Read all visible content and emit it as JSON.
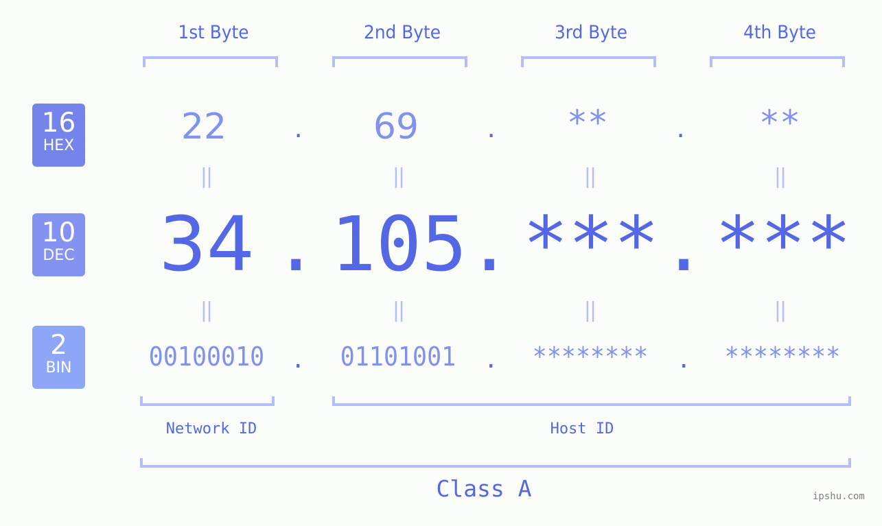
{
  "colors": {
    "primary": "#5468e6",
    "light": "#8291ee",
    "bracket": "#b5bef6",
    "hex_badge": "#7484ea",
    "dec_badge": "#8493f1",
    "bin_badge": "#8ea6f8",
    "background": "#fbfdfb"
  },
  "bytes": {
    "headers": [
      "1st Byte",
      "2nd Byte",
      "3rd Byte",
      "4th Byte"
    ]
  },
  "rows": {
    "hex": {
      "base": "16",
      "label": "HEX",
      "values": [
        "22",
        "69",
        "**",
        "**"
      ]
    },
    "dec": {
      "base": "10",
      "label": "DEC",
      "values": [
        "34",
        "105",
        "***",
        "***"
      ]
    },
    "bin": {
      "base": "2",
      "label": "BIN",
      "values": [
        "00100010",
        "01101001",
        "********",
        "********"
      ]
    }
  },
  "separator": ".",
  "equals": "||",
  "parts": {
    "network": "Network ID",
    "host": "Host ID",
    "class": "Class A"
  },
  "watermark": "ipshu.com"
}
